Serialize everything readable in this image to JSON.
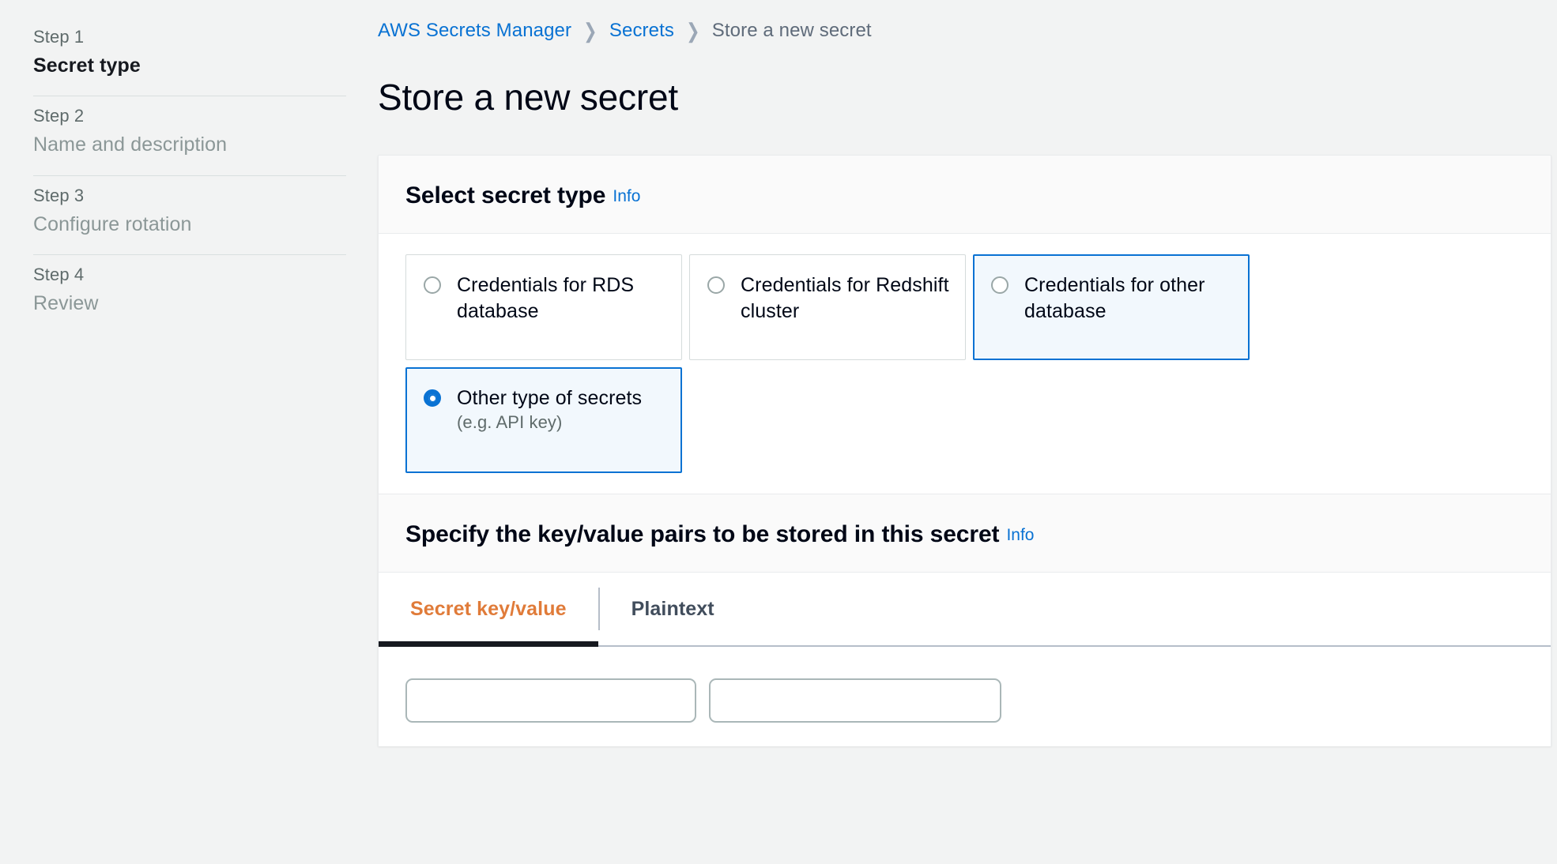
{
  "sidebar": {
    "steps": [
      {
        "number": "Step 1",
        "label": "Secret type",
        "active": true
      },
      {
        "number": "Step 2",
        "label": "Name and description",
        "active": false
      },
      {
        "number": "Step 3",
        "label": "Configure rotation",
        "active": false
      },
      {
        "number": "Step 4",
        "label": "Review",
        "active": false
      }
    ]
  },
  "breadcrumb": {
    "items": [
      {
        "label": "AWS Secrets Manager",
        "link": true
      },
      {
        "label": "Secrets",
        "link": true
      },
      {
        "label": "Store a new secret",
        "link": false
      }
    ],
    "separator": "›"
  },
  "page": {
    "title": "Store a new secret"
  },
  "secret_type_section": {
    "heading": "Select secret type",
    "info_label": "Info",
    "options": [
      {
        "label": "Credentials for RDS database",
        "sublabel": "",
        "selected": false,
        "highlighted": false
      },
      {
        "label": "Credentials for Redshift cluster",
        "sublabel": "",
        "selected": false,
        "highlighted": false
      },
      {
        "label": "Credentials for other database",
        "sublabel": "",
        "selected": false,
        "highlighted": true
      },
      {
        "label": "Other type of secrets",
        "sublabel": "(e.g. API key)",
        "selected": true,
        "highlighted": false
      }
    ]
  },
  "keyvalue_section": {
    "heading": "Specify the key/value pairs to be stored in this secret",
    "info_label": "Info",
    "tabs": [
      {
        "label": "Secret key/value",
        "active": true
      },
      {
        "label": "Plaintext",
        "active": false
      }
    ],
    "key_input": {
      "value": "",
      "placeholder": ""
    },
    "value_input": {
      "value": "",
      "placeholder": ""
    }
  },
  "colors": {
    "accent_blue": "#0972d3",
    "active_tab_orange": "#e07b39",
    "page_background": "#f2f3f3",
    "tile_selected_background": "#f2f8fd"
  }
}
